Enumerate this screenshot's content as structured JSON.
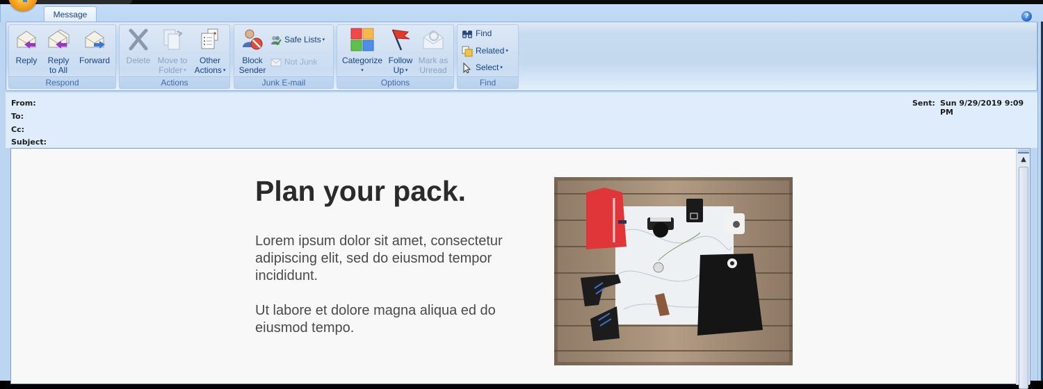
{
  "window": {
    "active_tab": "Message",
    "help_icon": "help-icon"
  },
  "ribbon": {
    "groups": [
      {
        "label": "Respond",
        "buttons": [
          {
            "label": "Reply",
            "icon": "reply-icon",
            "enabled": true
          },
          {
            "label_lines": [
              "Reply",
              "to All"
            ],
            "icon": "reply-all-icon",
            "enabled": true
          },
          {
            "label": "Forward",
            "icon": "forward-icon",
            "enabled": true
          }
        ]
      },
      {
        "label": "Actions",
        "buttons": [
          {
            "label": "Delete",
            "icon": "delete-icon",
            "enabled": false
          },
          {
            "label_lines": [
              "Move to",
              "Folder"
            ],
            "icon": "move-to-folder-icon",
            "enabled": false,
            "dropdown": true
          },
          {
            "label_lines": [
              "Other",
              "Actions"
            ],
            "icon": "other-actions-icon",
            "enabled": true,
            "dropdown": true
          }
        ]
      },
      {
        "label": "Junk E-mail",
        "buttons": [
          {
            "label_lines": [
              "Block",
              "Sender"
            ],
            "icon": "block-sender-icon",
            "enabled": true
          },
          {
            "label": "Safe Lists",
            "icon": "safe-lists-icon",
            "enabled": true,
            "dropdown": true
          },
          {
            "label": "Not Junk",
            "icon": "not-junk-icon",
            "enabled": false
          }
        ]
      },
      {
        "label": "Options",
        "buttons": [
          {
            "label": "Categorize",
            "icon": "categorize-icon",
            "enabled": true,
            "dropdown": true
          },
          {
            "label_lines": [
              "Follow",
              "Up"
            ],
            "icon": "follow-up-flag-icon",
            "enabled": true,
            "dropdown": true
          },
          {
            "label_lines": [
              "Mark as",
              "Unread"
            ],
            "icon": "mark-unread-icon",
            "enabled": false
          }
        ]
      },
      {
        "label": "Find",
        "buttons": [
          {
            "label": "Find",
            "icon": "binoculars-icon",
            "enabled": true
          },
          {
            "label": "Related",
            "icon": "related-icon",
            "enabled": true,
            "dropdown": true
          },
          {
            "label": "Select",
            "icon": "cursor-select-icon",
            "enabled": true,
            "dropdown": true
          }
        ]
      }
    ]
  },
  "header": {
    "from_label": "From:",
    "to_label": "To:",
    "cc_label": "Cc:",
    "subject_label": "Subject:",
    "sent_label": "Sent:",
    "sent_value": "Sun 9/29/2019 9:09 PM"
  },
  "email": {
    "headline": "Plan your pack.",
    "paragraph1": "Lorem ipsum dolor sit amet, consectetur adipiscing elit, sed do eiusmod tempor incididunt.",
    "paragraph2": "Ut labore et dolore magna aliqua ed do eiusmod tempo.",
    "image_alt": "Flat-lay of hiking gear on wooden planks: red jacket, map, camera, compass, boots, black backpack"
  }
}
